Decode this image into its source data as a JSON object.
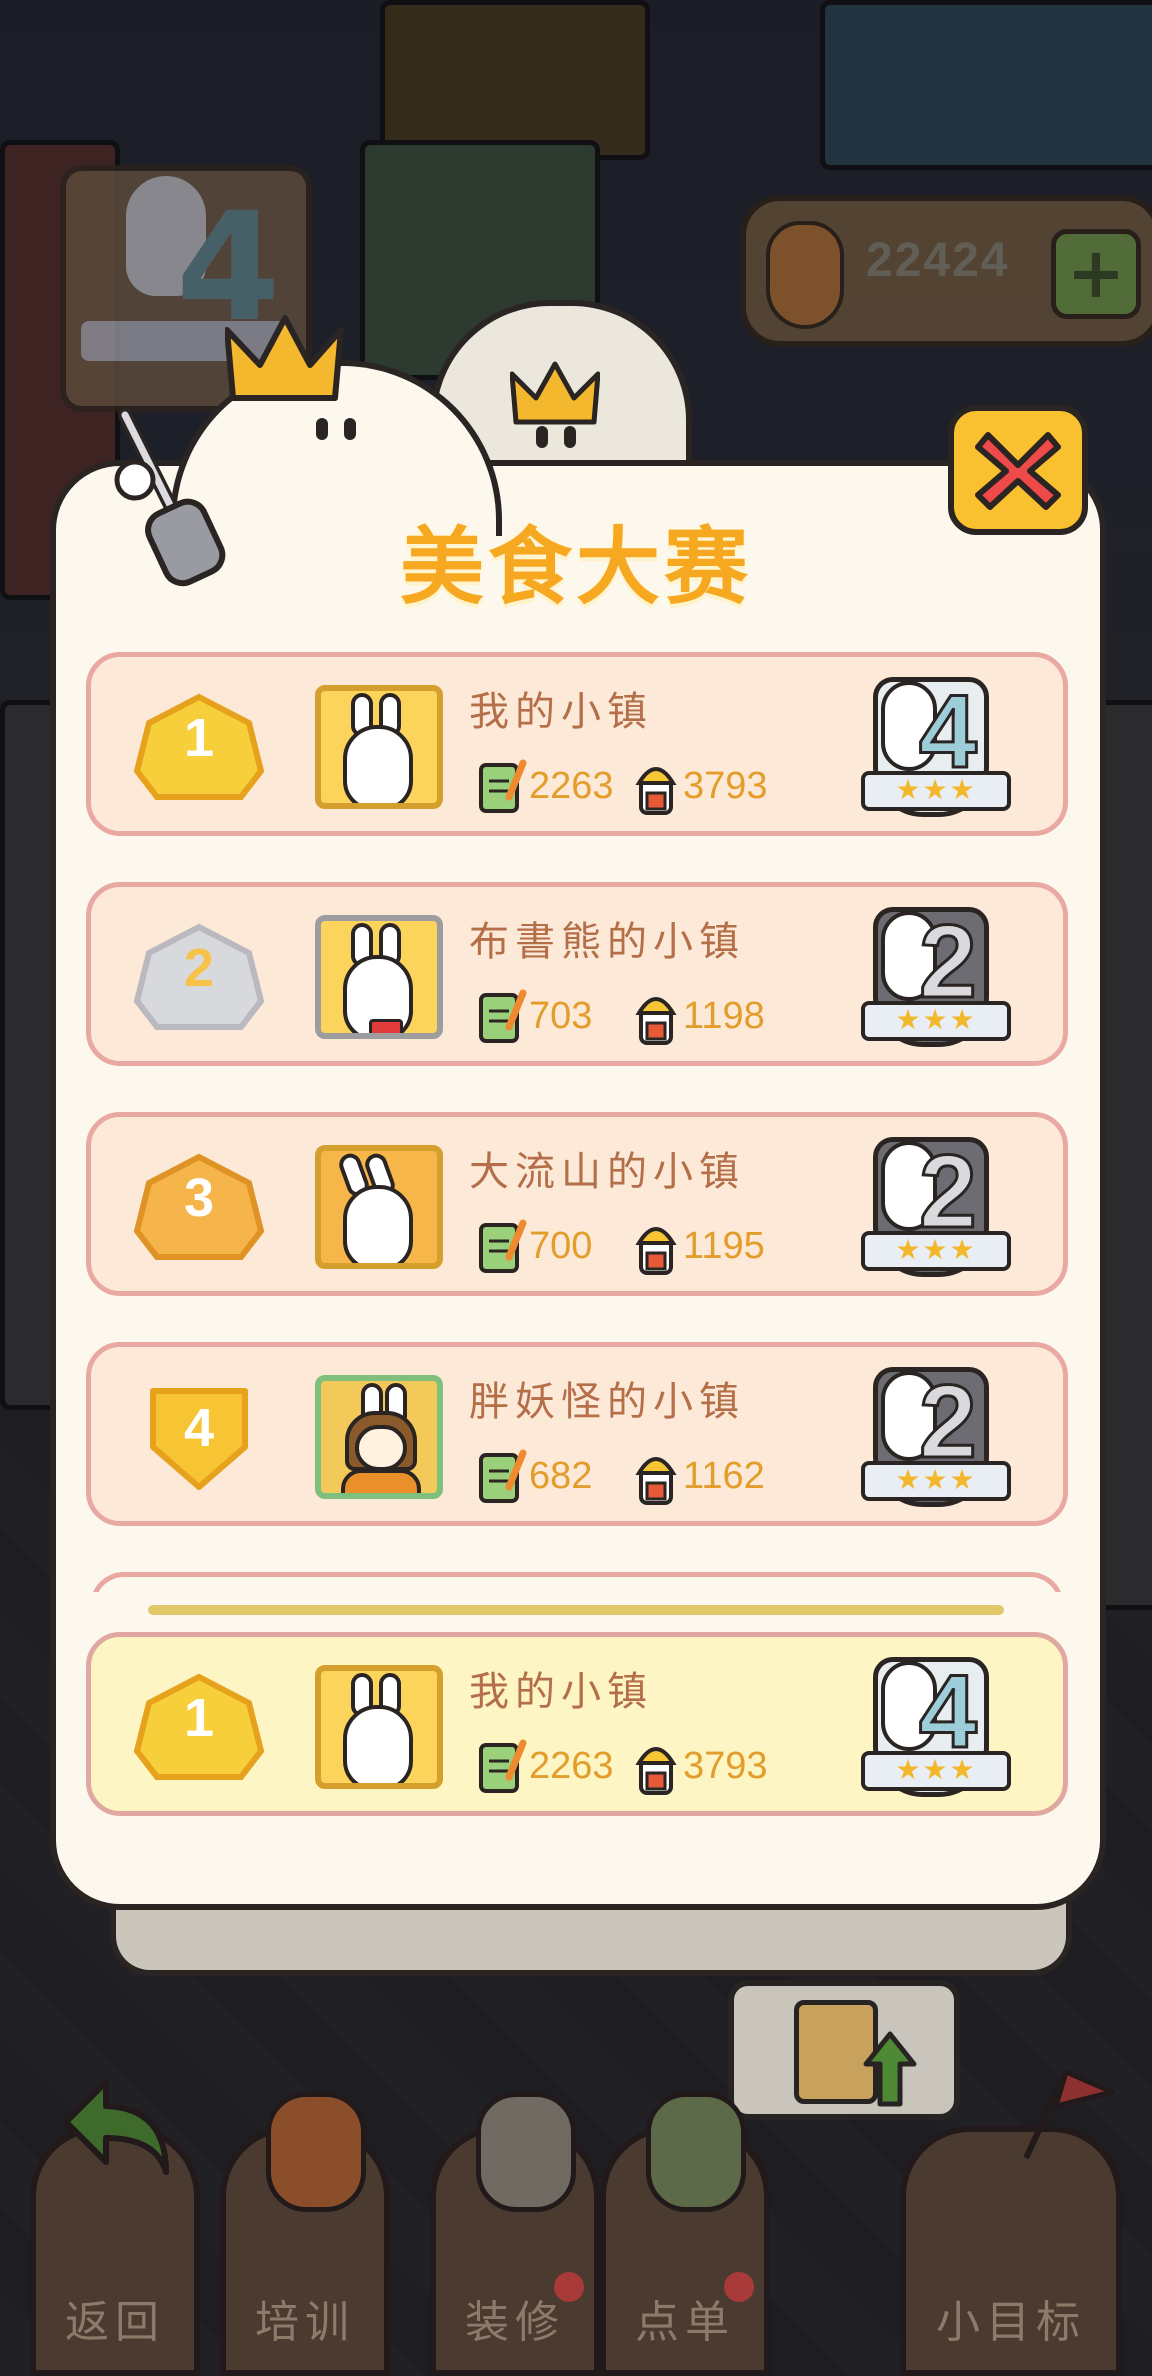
{
  "hud": {
    "top_left_level": "4",
    "coin_value": "22424",
    "coin_plus": "+"
  },
  "panel": {
    "title": "美食大赛",
    "close_icon": "close-x-icon"
  },
  "rows": [
    {
      "rank": "1",
      "name": "我的小镇",
      "dishes": "2263",
      "score": "3793",
      "level": "4",
      "avatar": "white-bunny-tongue",
      "level_stars": "★★★"
    },
    {
      "rank": "2",
      "name": "布書熊的小镇",
      "dishes": "703",
      "score": "1198",
      "level": "2",
      "avatar": "white-bunny-bowtie",
      "level_stars": "★★★"
    },
    {
      "rank": "3",
      "name": "大流山的小镇",
      "dishes": "700",
      "score": "1195",
      "level": "2",
      "avatar": "white-bunny-laughing",
      "level_stars": "★★★"
    },
    {
      "rank": "4",
      "name": "胖妖怪的小镇",
      "dishes": "682",
      "score": "1162",
      "level": "2",
      "avatar": "bunny-girl",
      "level_stars": "★★★"
    }
  ],
  "my_row": {
    "rank": "1",
    "name": "我的小镇",
    "dishes": "2263",
    "score": "3793",
    "level": "4",
    "level_stars": "★★★"
  },
  "bottom_nav": [
    {
      "label": "返回",
      "icon": "back-arrow-icon"
    },
    {
      "label": "培训",
      "icon": "carrot-trainer-icon"
    },
    {
      "label": "装修",
      "icon": "builder-bunny-icon"
    },
    {
      "label": "点单",
      "icon": "order-list-icon"
    },
    {
      "label": "小目标",
      "icon": "goal-flag-icon"
    }
  ],
  "colors": {
    "panel_bg": "#fdf8ed",
    "row_bg": "#fde9d8",
    "my_row_bg": "#fdf5c4",
    "title": "#f6a821",
    "stat_text": "#e39d2b",
    "name_text": "#b46e48",
    "gold": "#f7cf3a",
    "silver": "#d8d9dd",
    "bronze": "#f6b54a"
  }
}
